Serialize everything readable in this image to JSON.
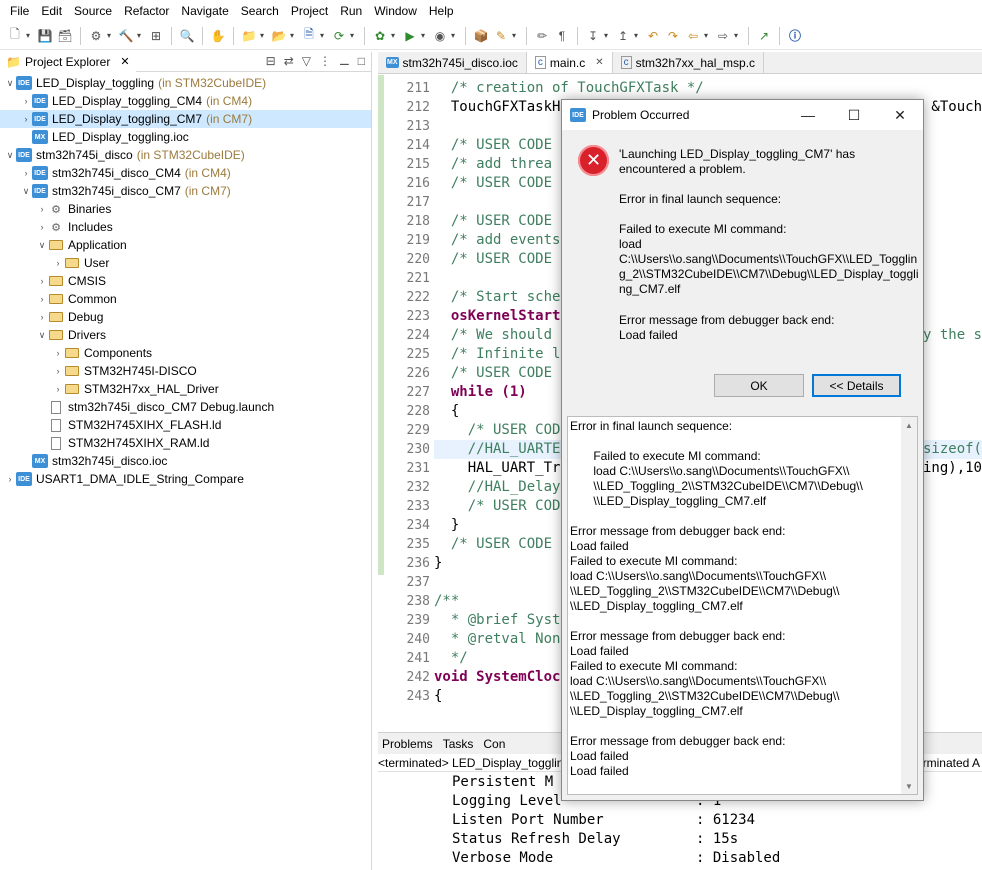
{
  "menu": [
    "File",
    "Edit",
    "Source",
    "Refactor",
    "Navigate",
    "Search",
    "Project",
    "Run",
    "Window",
    "Help"
  ],
  "explorer": {
    "tab_label": "Project Explorer",
    "items": [
      {
        "label": "LED_Display_toggling",
        "ann": "(in STM32CubeIDE)",
        "depth": 0,
        "icon": "ide",
        "tw": "v"
      },
      {
        "label": "LED_Display_toggling_CM4",
        "ann": "(in CM4)",
        "depth": 1,
        "icon": "ide",
        "tw": ">"
      },
      {
        "label": "LED_Display_toggling_CM7",
        "ann": "(in CM7)",
        "depth": 1,
        "icon": "ide",
        "tw": ">",
        "selected": true
      },
      {
        "label": "LED_Display_toggling.ioc",
        "ann": "",
        "depth": 1,
        "icon": "mx",
        "tw": ""
      },
      {
        "label": "stm32h745i_disco",
        "ann": "(in STM32CubeIDE)",
        "depth": 0,
        "icon": "ide",
        "tw": "v"
      },
      {
        "label": "stm32h745i_disco_CM4",
        "ann": "(in CM4)",
        "depth": 1,
        "icon": "ide",
        "tw": ">"
      },
      {
        "label": "stm32h745i_disco_CM7",
        "ann": "(in CM7)",
        "depth": 1,
        "icon": "ide",
        "tw": "v"
      },
      {
        "label": "Binaries",
        "ann": "",
        "depth": 2,
        "icon": "bin",
        "tw": ">"
      },
      {
        "label": "Includes",
        "ann": "",
        "depth": 2,
        "icon": "bin",
        "tw": ">"
      },
      {
        "label": "Application",
        "ann": "",
        "depth": 2,
        "icon": "folder",
        "tw": "v"
      },
      {
        "label": "User",
        "ann": "",
        "depth": 3,
        "icon": "folder",
        "tw": ">"
      },
      {
        "label": "CMSIS",
        "ann": "",
        "depth": 2,
        "icon": "folder",
        "tw": ">"
      },
      {
        "label": "Common",
        "ann": "",
        "depth": 2,
        "icon": "folder",
        "tw": ">"
      },
      {
        "label": "Debug",
        "ann": "",
        "depth": 2,
        "icon": "folder",
        "tw": ">"
      },
      {
        "label": "Drivers",
        "ann": "",
        "depth": 2,
        "icon": "folder",
        "tw": "v"
      },
      {
        "label": "Components",
        "ann": "",
        "depth": 3,
        "icon": "folder",
        "tw": ">"
      },
      {
        "label": "STM32H745I-DISCO",
        "ann": "",
        "depth": 3,
        "icon": "folder",
        "tw": ">"
      },
      {
        "label": "STM32H7xx_HAL_Driver",
        "ann": "",
        "depth": 3,
        "icon": "folder",
        "tw": ">"
      },
      {
        "label": "stm32h745i_disco_CM7 Debug.launch",
        "ann": "",
        "depth": 2,
        "icon": "file",
        "tw": ""
      },
      {
        "label": "STM32H745XIHX_FLASH.ld",
        "ann": "",
        "depth": 2,
        "icon": "file",
        "tw": ""
      },
      {
        "label": "STM32H745XIHX_RAM.ld",
        "ann": "",
        "depth": 2,
        "icon": "file",
        "tw": ""
      },
      {
        "label": "stm32h745i_disco.ioc",
        "ann": "",
        "depth": 1,
        "icon": "mx",
        "tw": ""
      },
      {
        "label": "USART1_DMA_IDLE_String_Compare",
        "ann": "",
        "depth": 0,
        "icon": "ide",
        "tw": ">"
      }
    ]
  },
  "editor": {
    "tabs": [
      {
        "label": "stm32h745i_disco.ioc",
        "icon": "MX",
        "active": false
      },
      {
        "label": "main.c",
        "icon": "c",
        "active": true
      },
      {
        "label": "stm32h7xx_hal_msp.c",
        "icon": "c",
        "active": false
      }
    ],
    "lines": [
      {
        "n": "211",
        "t": "  /* creation of TouchGFXTask */",
        "c": "cm"
      },
      {
        "n": "212",
        "t": "  TouchGFXTaskH",
        "c": "",
        "right": "&Touch"
      },
      {
        "n": "213",
        "t": "",
        "c": ""
      },
      {
        "n": "214",
        "t": "  /* USER CODE",
        "c": "cm"
      },
      {
        "n": "215",
        "t": "  /* add threa",
        "c": "cm"
      },
      {
        "n": "216",
        "t": "  /* USER CODE",
        "c": "cm"
      },
      {
        "n": "217",
        "t": "",
        "c": ""
      },
      {
        "n": "218",
        "t": "  /* USER CODE",
        "c": "cm"
      },
      {
        "n": "219",
        "t": "  /* add events",
        "c": "cm"
      },
      {
        "n": "220",
        "t": "  /* USER CODE",
        "c": "cm"
      },
      {
        "n": "221",
        "t": "",
        "c": ""
      },
      {
        "n": "222",
        "t": "  /* Start sche",
        "c": "cm"
      },
      {
        "n": "223",
        "t": "  osKernelStart",
        "c": "kw"
      },
      {
        "n": "224",
        "t": "  /* We should",
        "c": "cm",
        "right": "y the s"
      },
      {
        "n": "225",
        "t": "  /* Infinite l",
        "c": "cm"
      },
      {
        "n": "226",
        "t": "  /* USER CODE",
        "c": "cm"
      },
      {
        "n": "227",
        "t": "  while (1)",
        "c": "kwl"
      },
      {
        "n": "228",
        "t": "  {",
        "c": ""
      },
      {
        "n": "229",
        "t": "    /* USER COD",
        "c": "cm"
      },
      {
        "n": "230",
        "t": "    //HAL_UARTE",
        "c": "cm",
        "right": "sizeof(",
        "hl": true
      },
      {
        "n": "231",
        "t": "    HAL_UART_Tr",
        "c": "",
        "right": "ing),10"
      },
      {
        "n": "232",
        "t": "    //HAL_Delay",
        "c": "cm"
      },
      {
        "n": "233",
        "t": "    /* USER COD",
        "c": "cm"
      },
      {
        "n": "234",
        "t": "  }",
        "c": ""
      },
      {
        "n": "235",
        "t": "  /* USER CODE",
        "c": "cm"
      },
      {
        "n": "236",
        "t": "}",
        "c": ""
      },
      {
        "n": "237",
        "t": "",
        "c": ""
      },
      {
        "n": "238",
        "t": "/**",
        "c": "cm",
        "fold": true
      },
      {
        "n": "239",
        "t": "  * @brief Syst",
        "c": "cm"
      },
      {
        "n": "240",
        "t": "  * @retval Non",
        "c": "cm"
      },
      {
        "n": "241",
        "t": "  */",
        "c": "cm"
      },
      {
        "n": "242",
        "t": "void SystemCloc",
        "c": "kwl",
        "fold": true
      },
      {
        "n": "243",
        "t": "{",
        "c": ""
      }
    ]
  },
  "console": {
    "tabs": [
      "Problems",
      "Tasks",
      "Con"
    ],
    "status": "<terminated> LED_Display_togglin",
    "status_right": "rminated A",
    "lines": [
      {
        "k": "Persistent M",
        "v": ""
      },
      {
        "k": "Logging Level",
        "v": ": 1"
      },
      {
        "k": "Listen Port Number",
        "v": ": 61234"
      },
      {
        "k": "Status Refresh Delay",
        "v": ": 15s"
      },
      {
        "k": "Verbose Mode",
        "v": ": Disabled"
      }
    ]
  },
  "dialog": {
    "title": "Problem Occurred",
    "msg1": "'Launching LED_Display_toggling_CM7' has encountered a problem.",
    "msg2": "Error in final launch sequence:",
    "msg3": "Failed to execute MI command:\nload\nC:\\\\Users\\\\o.sang\\\\Documents\\\\TouchGFX\\\\LED_Toggling_2\\\\STM32CubeIDE\\\\CM7\\\\Debug\\\\LED_Display_toggling_CM7.elf",
    "msg4": "Error message from debugger back end:\nLoad failed",
    "ok_label": "OK",
    "details_label": "<< Details",
    "details_text": "Error in final launch sequence:\n\n       Failed to execute MI command:\n       load C:\\\\Users\\\\o.sang\\\\Documents\\\\TouchGFX\\\\\n       \\\\LED_Toggling_2\\\\STM32CubeIDE\\\\CM7\\\\Debug\\\\\n       \\\\LED_Display_toggling_CM7.elf\n\nError message from debugger back end:\nLoad failed\nFailed to execute MI command:\nload C:\\\\Users\\\\o.sang\\\\Documents\\\\TouchGFX\\\\\n\\\\LED_Toggling_2\\\\STM32CubeIDE\\\\CM7\\\\Debug\\\\\n\\\\LED_Display_toggling_CM7.elf\n\nError message from debugger back end:\nLoad failed\nFailed to execute MI command:\nload C:\\\\Users\\\\o.sang\\\\Documents\\\\TouchGFX\\\\\n\\\\LED_Toggling_2\\\\STM32CubeIDE\\\\CM7\\\\Debug\\\\\n\\\\LED_Display_toggling_CM7.elf\n\nError message from debugger back end:\nLoad failed\nLoad failed"
  }
}
